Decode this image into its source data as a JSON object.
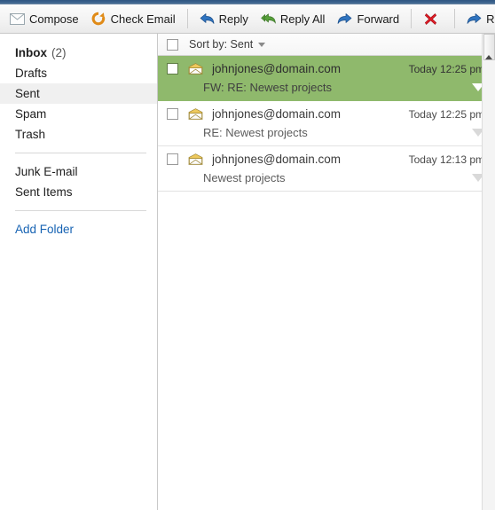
{
  "toolbar": {
    "items": [
      {
        "label": "Compose",
        "icon": "envelope-icon"
      },
      {
        "label": "Check Email",
        "icon": "refresh-icon"
      },
      {
        "label": "Reply",
        "icon": "reply-arrow-icon"
      },
      {
        "label": "Reply All",
        "icon": "reply-all-arrow-icon"
      },
      {
        "label": "Forward",
        "icon": "forward-arrow-icon"
      },
      {
        "label": "",
        "icon": "delete-x-icon"
      },
      {
        "label": "Re-Send Email",
        "icon": "resend-arrow-icon"
      },
      {
        "label": "",
        "icon": "folder-icon"
      }
    ]
  },
  "sidebar": {
    "folders": [
      {
        "label": "Inbox",
        "count": "(2)",
        "bold": true,
        "selected": false
      },
      {
        "label": "Drafts",
        "count": "",
        "bold": false,
        "selected": false
      },
      {
        "label": "Sent",
        "count": "",
        "bold": false,
        "selected": true
      },
      {
        "label": "Spam",
        "count": "",
        "bold": false,
        "selected": false
      },
      {
        "label": "Trash",
        "count": "",
        "bold": false,
        "selected": false
      }
    ],
    "custom_folders": [
      {
        "label": "Junk E-mail"
      },
      {
        "label": "Sent Items"
      }
    ],
    "add_folder_label": "Add Folder"
  },
  "list_header": {
    "sort_label": "Sort by: Sent",
    "sort_icon": "chevron-down-icon",
    "select_all_checked": false
  },
  "messages": [
    {
      "sender": "johnjones@domain.com",
      "subject": "FW: RE: Newest projects",
      "timestamp": "Today 12:25 pm",
      "selected": true,
      "checked": false,
      "icon": "open-envelope-icon"
    },
    {
      "sender": "johnjones@domain.com",
      "subject": "RE: Newest projects",
      "timestamp": "Today 12:25 pm",
      "selected": false,
      "checked": false,
      "icon": "open-envelope-icon"
    },
    {
      "sender": "johnjones@domain.com",
      "subject": "Newest projects",
      "timestamp": "Today 12:13 pm",
      "selected": false,
      "checked": false,
      "icon": "open-envelope-icon"
    }
  ],
  "colors": {
    "selected_row": "#8fb96c",
    "sidebar_selected": "#f0f0f0",
    "link": "#1763b3",
    "chrome": "#3c658f"
  }
}
